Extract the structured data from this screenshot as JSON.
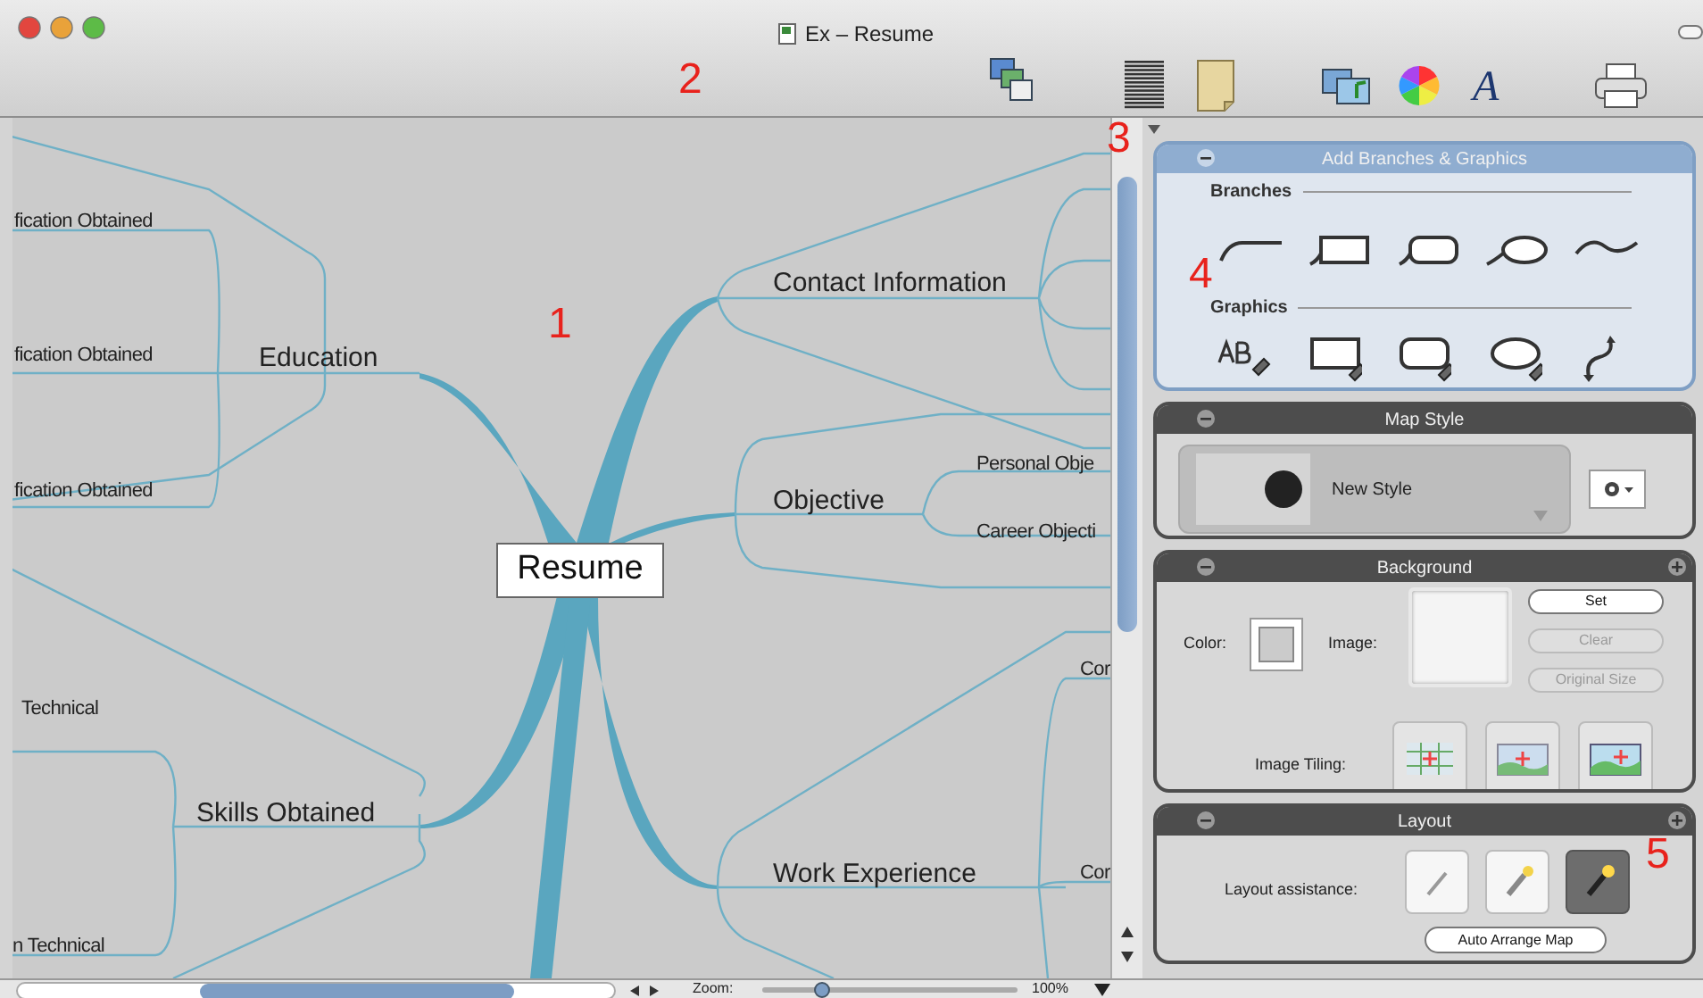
{
  "window": {
    "title": "Ex – Resume"
  },
  "toolbar": {
    "font_glyph": "A"
  },
  "map": {
    "central": "Resume",
    "branches": [
      {
        "label": "Contact Information"
      },
      {
        "label": "Education",
        "children": [
          "fication Obtained",
          "fication Obtained",
          "fication Obtained"
        ]
      },
      {
        "label": "Objective",
        "children": [
          "Personal Obje",
          "Career Objecti"
        ]
      },
      {
        "label": "Skills Obtained",
        "children": [
          "Technical",
          "n Technical"
        ]
      },
      {
        "label": "Work Experience",
        "children": [
          "Cor",
          "Cor"
        ]
      }
    ]
  },
  "zoom": {
    "label": "Zoom:",
    "level": 0.23,
    "reading": "100%"
  },
  "add_panel": {
    "title": "Add Branches & Graphics",
    "branches_label": "Branches",
    "graphics_label": "Graphics"
  },
  "map_style": {
    "title": "Map Style",
    "style_name": "New Style"
  },
  "background": {
    "title": "Background",
    "color_label": "Color:",
    "image_label": "Image:",
    "buttons": [
      {
        "label": "Set",
        "disabled": false
      },
      {
        "label": "Clear",
        "disabled": true
      },
      {
        "label": "Original Size",
        "disabled": true
      }
    ],
    "tiling_label": "Image Tiling:"
  },
  "layout": {
    "title": "Layout",
    "assistance_label": "Layout assistance:",
    "options": [
      {
        "selected": false
      },
      {
        "selected": false
      },
      {
        "selected": true
      }
    ],
    "arrange_button": "Auto Arrange Map"
  },
  "callouts": [
    "1",
    "2",
    "3",
    "4",
    "5"
  ]
}
